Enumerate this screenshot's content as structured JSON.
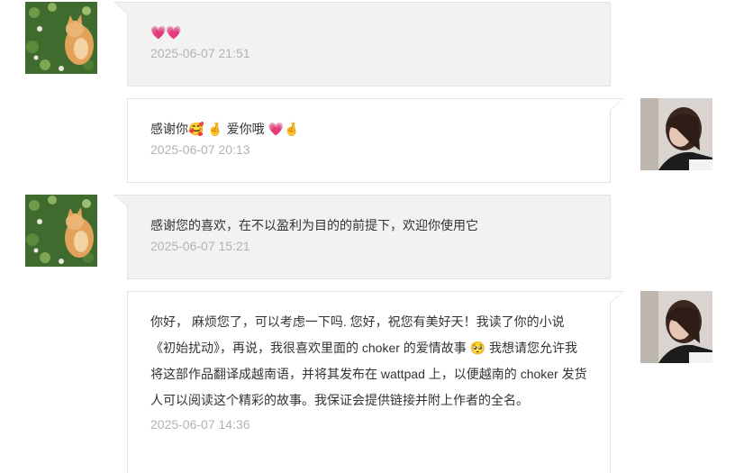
{
  "messages": [
    {
      "side": "left",
      "avatar": "cat-avatar",
      "text": "💗💗",
      "time": "2025-06-07 21:51"
    },
    {
      "side": "right",
      "avatar": "girl-avatar",
      "text": "感谢你🥰 🤞 爱你哦 💗🤞",
      "time": "2025-06-07 20:13"
    },
    {
      "side": "left",
      "avatar": "cat-avatar",
      "text": "感谢您的喜欢，在不以盈利为目的的前提下，欢迎你使用它",
      "time": "2025-06-07 15:21"
    },
    {
      "side": "right",
      "avatar": "girl-avatar",
      "text": "你好， 麻烦您了，可以考虑一下吗. 您好，祝您有美好天！我读了你的小说《初始扰动》，再说，我很喜欢里面的 choker 的爱情故事 🥺 我想请您允许我将这部作品翻译成越南语，并将其发布在 wattpad 上，以便越南的 choker 发货人可以阅读这个精彩的故事。我保证会提供链接并附上作者的全名。",
      "time": "2025-06-07 14:36"
    }
  ]
}
